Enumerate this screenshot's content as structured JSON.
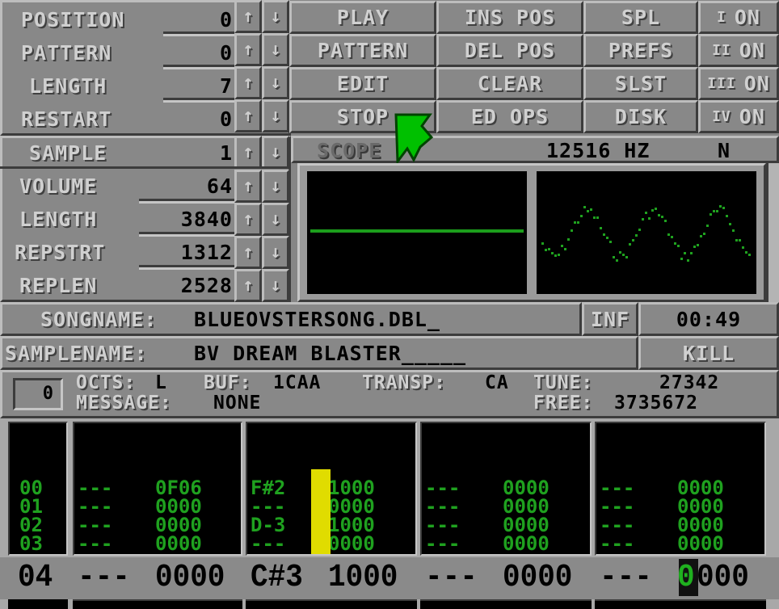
{
  "song_panel": {
    "rows": [
      {
        "label": "POSITION",
        "value": "0"
      },
      {
        "label": "PATTERN",
        "value": "0"
      },
      {
        "label": "LENGTH",
        "value": "7"
      },
      {
        "label": "RESTART",
        "value": "0"
      }
    ],
    "up_icon": "↑",
    "down_icon": "↓"
  },
  "buttons": {
    "col1": [
      "PLAY",
      "PATTERN",
      "EDIT",
      "STOP"
    ],
    "col2": [
      "INS POS",
      "DEL POS",
      "CLEAR",
      "ED OPS"
    ],
    "col3": [
      "SPL",
      "PREFS",
      "SLST",
      "DISK"
    ],
    "channels": [
      {
        "numeral": "I",
        "state": "ON"
      },
      {
        "numeral": "II",
        "state": "ON"
      },
      {
        "numeral": "III",
        "state": "ON"
      },
      {
        "numeral": "IV",
        "state": "ON"
      }
    ]
  },
  "sample_panel": {
    "sample_label": "SAMPLE",
    "sample_value": "1",
    "rows": [
      {
        "label": "VOLUME",
        "value": "64"
      },
      {
        "label": "LENGTH",
        "value": "3840"
      },
      {
        "label": "REPSTRT",
        "value": "1312"
      },
      {
        "label": "REPLEN",
        "value": "2528"
      }
    ]
  },
  "scope": {
    "label": "SCOPE",
    "frequency": "12516 HZ",
    "mode": "N"
  },
  "songname": {
    "label": "SONGNAME:",
    "value": "BLUEOVSTERSONG.DBL_"
  },
  "inf_label": "INF",
  "time": "00:49",
  "samplename": {
    "label": "SAMPLENAME:",
    "value": "BV DREAM BLASTER_____"
  },
  "kill_label": "KILL",
  "status": {
    "edit_step": "0",
    "octs_label": "OCTS:",
    "octs_value": "L",
    "buf_label": "BUF:",
    "buf_value": "1CAA",
    "transp_label": "TRANSP:",
    "transp_value": "CA",
    "tune_label": "TUNE:",
    "tune_value": "27342",
    "message_label": "MESSAGE:",
    "message_value": "NONE",
    "free_label": "FREE:",
    "free_value": "3735672"
  },
  "pattern": {
    "row_numbers": [
      "00",
      "01",
      "02",
      "03"
    ],
    "current_row": "04",
    "tracks": [
      {
        "rows": [
          [
            "---",
            "0F06"
          ],
          [
            "---",
            "0000"
          ],
          [
            "---",
            "0000"
          ],
          [
            "---",
            "0000"
          ]
        ],
        "current": [
          "---",
          "0000"
        ]
      },
      {
        "rows": [
          [
            "F#2",
            "1000"
          ],
          [
            "---",
            "0000"
          ],
          [
            "D-3",
            "1000"
          ],
          [
            "---",
            "0000"
          ]
        ],
        "current": [
          "C#3",
          "1000"
        ]
      },
      {
        "rows": [
          [
            "---",
            "0000"
          ],
          [
            "---",
            "0000"
          ],
          [
            "---",
            "0000"
          ],
          [
            "---",
            "0000"
          ]
        ],
        "current": [
          "---",
          "0000"
        ]
      },
      {
        "rows": [
          [
            "---",
            "0000"
          ],
          [
            "---",
            "0000"
          ],
          [
            "---",
            "0000"
          ],
          [
            "---",
            "0000"
          ]
        ],
        "current": [
          "---",
          "0000"
        ]
      }
    ],
    "cursor_char": "0",
    "cursor_rest": "000"
  },
  "colors": {
    "panel": "#888888",
    "highlight": "#bdbdbd",
    "shadow": "#3c3c3c",
    "pattern_text": "#1fa11f",
    "vu_meter": "#e0dc00",
    "mouse_pointer": "#00c000"
  }
}
